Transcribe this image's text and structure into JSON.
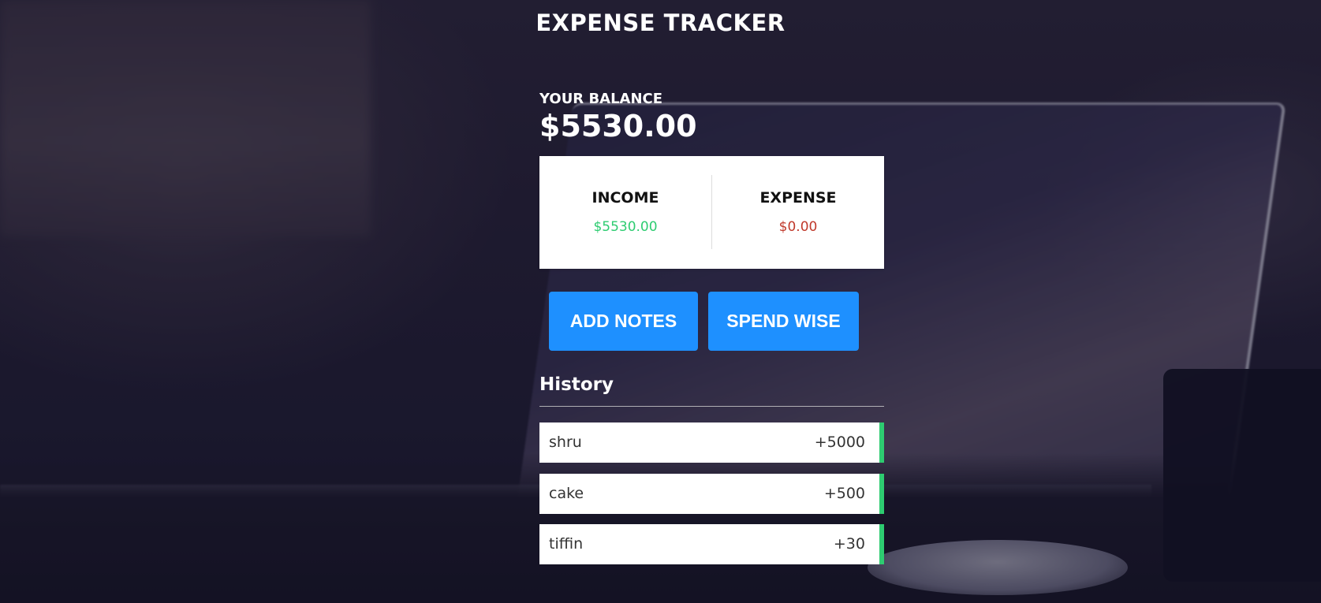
{
  "app": {
    "title": "EXPENSE TRACKER"
  },
  "balance": {
    "label": "YOUR BALANCE",
    "value": "$5530.00"
  },
  "summary": {
    "income_label": "INCOME",
    "income_value": "$5530.00",
    "expense_label": "EXPENSE",
    "expense_value": "$0.00"
  },
  "actions": {
    "add_notes_label": "ADD NOTES",
    "spend_wise_label": "SPEND WISE"
  },
  "history": {
    "title": "History",
    "items": [
      {
        "text": "shru",
        "amount": "+5000"
      },
      {
        "text": "cake",
        "amount": "+500"
      },
      {
        "text": "tiffin",
        "amount": "+30"
      }
    ]
  },
  "colors": {
    "income": "#2ecc71",
    "expense": "#c0392b",
    "button": "#1e90ff",
    "positive_border": "#2ecc71"
  }
}
